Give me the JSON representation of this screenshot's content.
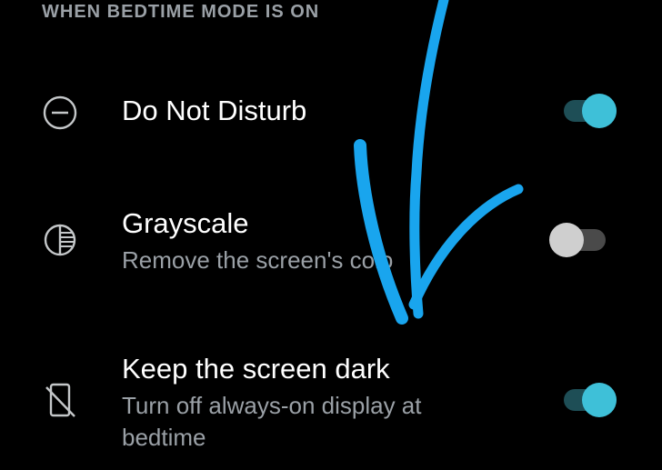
{
  "section": {
    "header": "WHEN BEDTIME MODE IS ON"
  },
  "rows": [
    {
      "title": "Do Not Disturb",
      "subtitle": "",
      "icon": "do-not-disturb-icon",
      "toggle_on": true
    },
    {
      "title": "Grayscale",
      "subtitle": "Remove the screen's colo",
      "icon": "grayscale-icon",
      "toggle_on": false
    },
    {
      "title": "Keep the screen dark",
      "subtitle": "Turn off always-on display at bedtime",
      "icon": "phone-off-icon",
      "toggle_on": true
    }
  ],
  "colors": {
    "background": "#000000",
    "accent": "#3ec0d8",
    "annotation_stroke": "#19a5ee",
    "secondary_text": "#9aa0a6"
  }
}
